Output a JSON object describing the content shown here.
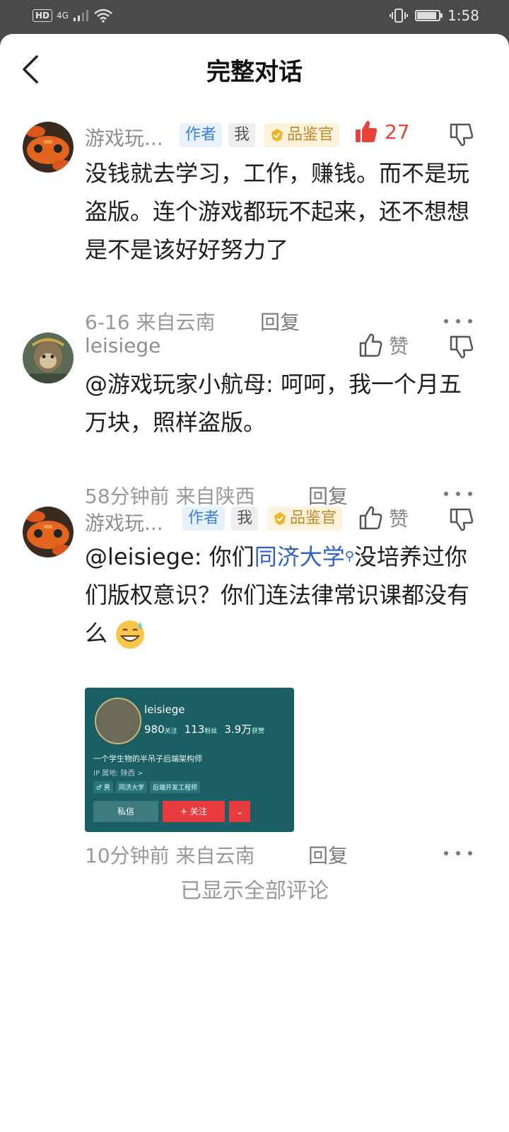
{
  "status_bar": {
    "network": "HD",
    "signal": "4G",
    "time": "1:58",
    "battery_level": 0.9
  },
  "header": {
    "title": "完整对话"
  },
  "comments": [
    {
      "username": "游戏玩...",
      "badges": {
        "author": "作者",
        "me": "我",
        "judge": "品鉴官"
      },
      "likes": "27",
      "liked": true,
      "text": "没钱就去学习，工作，赚钱。而不是玩盗版。连个游戏都玩不起来，还不想想是不是该好好努力了",
      "meta": "6-16 来自云南",
      "reply_label": "回复"
    },
    {
      "username": "leisiege",
      "likes": "赞",
      "liked": false,
      "text": "@游戏玩家小航母: 呵呵，我一个月五万块，照样盗版。",
      "meta": "58分钟前 来自陕西",
      "reply_label": "回复"
    },
    {
      "username": "游戏玩...",
      "badges": {
        "author": "作者",
        "me": "我",
        "judge": "品鉴官"
      },
      "likes": "赞",
      "liked": false,
      "text_prefix": "@leisiege: 你们",
      "text_link": "同济大学",
      "text_suffix": "没培养过你们版权意识？你们连法律常识课都没有么",
      "meta": "10分钟前 来自云南",
      "reply_label": "回复",
      "attachment": {
        "name": "leisiege",
        "following_count": "980",
        "following_label": "关注",
        "fans_count": "113",
        "fans_label": "粉丝",
        "likes_count": "3.9万",
        "likes_label": "获赞",
        "bio": "一个学生物的半吊子后端架构师",
        "ip": "IP 属地: 陕西 >",
        "tags": [
          "♂ 男",
          "同济大学",
          "后端开发工程师"
        ],
        "dm_label": "私信",
        "follow_label": "+ 关注",
        "more_label": "⌄"
      }
    }
  ],
  "footer": {
    "note": "已显示全部评论"
  },
  "colors": {
    "like_active": "#e7433c",
    "link": "#2e62c6",
    "author_tag": "#3e7fd6",
    "judge_tag": "#c08a2a"
  }
}
